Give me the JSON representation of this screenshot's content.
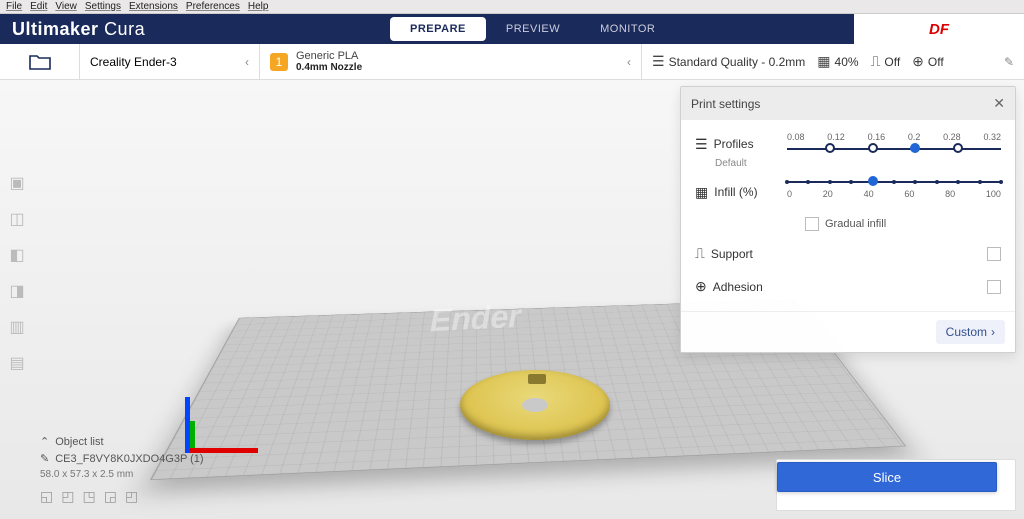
{
  "menubar": [
    "File",
    "Edit",
    "View",
    "Settings",
    "Extensions",
    "Preferences",
    "Help"
  ],
  "brand": {
    "bold": "Ultimaker",
    "light": "Cura"
  },
  "tabs": {
    "prepare": "PREPARE",
    "preview": "PREVIEW",
    "monitor": "MONITOR"
  },
  "watermark": "DF",
  "printer": "Creality Ender-3",
  "material": {
    "name": "Generic PLA",
    "nozzle": "0.4mm Nozzle",
    "badge": "1"
  },
  "quality_summary": "Standard Quality - 0.2mm",
  "infill_summary": "40%",
  "support_summary": "Off",
  "adhesion_summary": "Off",
  "panel": {
    "title": "Print settings",
    "profiles_label": "Profiles",
    "default_label": "Default",
    "profile_ticks": [
      "0.08",
      "0.12",
      "0.16",
      "0.2",
      "0.28",
      "0.32"
    ],
    "infill_label": "Infill (%)",
    "infill_ticks": [
      "0",
      "20",
      "40",
      "60",
      "80",
      "100"
    ],
    "gradual_label": "Gradual infill",
    "support_label": "Support",
    "adhesion_label": "Adhesion",
    "custom_label": "Custom"
  },
  "objectlist": {
    "header": "Object list",
    "item": "CE3_F8VY8K0JXDO4G3P (1)",
    "dims": "58.0 x 57.3 x 2.5 mm"
  },
  "platetext": "Ender",
  "slice": "Slice"
}
